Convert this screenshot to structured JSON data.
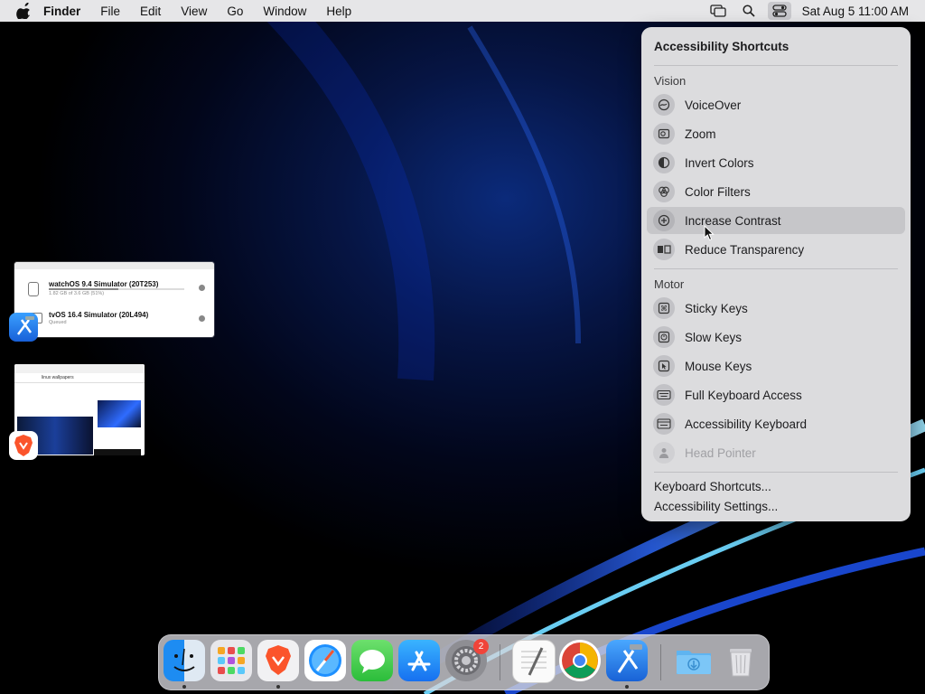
{
  "menubar": {
    "app_name": "Finder",
    "items": [
      "File",
      "Edit",
      "View",
      "Go",
      "Window",
      "Help"
    ],
    "clock": "Sat Aug 5  11:00 AM",
    "icons": [
      "apple-icon",
      "screen-mirroring-icon",
      "spotlight-icon",
      "control-center-icon"
    ]
  },
  "panel": {
    "title": "Accessibility Shortcuts",
    "sections": {
      "vision": "Vision",
      "motor": "Motor"
    },
    "vision_items": [
      {
        "label": "VoiceOver",
        "icon": "voiceover-icon"
      },
      {
        "label": "Zoom",
        "icon": "zoom-icon"
      },
      {
        "label": "Invert Colors",
        "icon": "invert-colors-icon"
      },
      {
        "label": "Color Filters",
        "icon": "color-filters-icon"
      },
      {
        "label": "Increase Contrast",
        "icon": "increase-contrast-icon",
        "highlighted": true
      },
      {
        "label": "Reduce Transparency",
        "icon": "reduce-transparency-icon"
      }
    ],
    "motor_items": [
      {
        "label": "Sticky Keys",
        "icon": "sticky-keys-icon"
      },
      {
        "label": "Slow Keys",
        "icon": "slow-keys-icon"
      },
      {
        "label": "Mouse Keys",
        "icon": "mouse-keys-icon"
      },
      {
        "label": "Full Keyboard Access",
        "icon": "full-keyboard-access-icon"
      },
      {
        "label": "Accessibility Keyboard",
        "icon": "accessibility-keyboard-icon"
      },
      {
        "label": "Head Pointer",
        "icon": "head-pointer-icon",
        "disabled": true
      }
    ],
    "links": [
      "Keyboard Shortcuts...",
      "Accessibility Settings..."
    ]
  },
  "thumbnails": {
    "simulator": {
      "rows": [
        {
          "title": "watchOS 9.4 Simulator (20T253)",
          "sub": "1.82 GB of 3.6 GB (51%)"
        },
        {
          "title": "tvOS 16.4 Simulator (20L494)",
          "sub": "Queued"
        }
      ]
    },
    "browser": {
      "search": "linux wallpapers"
    }
  },
  "dock": {
    "apps": [
      "finder",
      "launchpad",
      "brave",
      "safari",
      "messages",
      "app-store",
      "system-settings",
      "textedit",
      "chrome",
      "xcode",
      "downloads",
      "trash"
    ],
    "settings_badge": "2"
  },
  "colors": {
    "panel_bg": "#dcdcde",
    "highlight": "#c6c6c9",
    "menubar_bg": "#e6e6e8"
  }
}
